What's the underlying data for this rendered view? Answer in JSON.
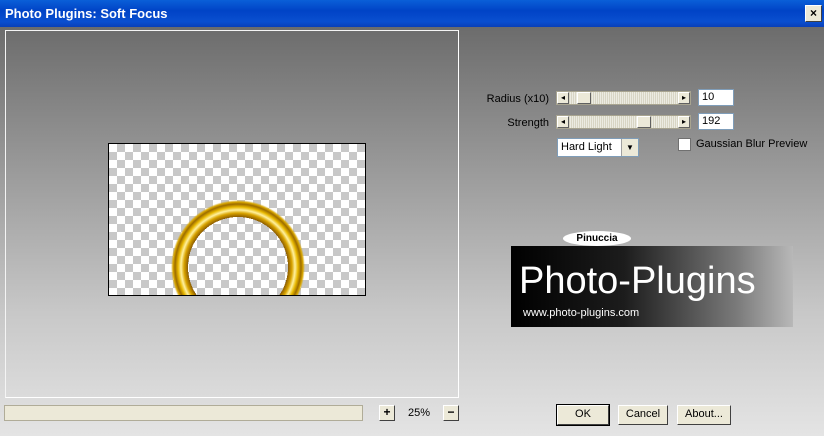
{
  "window": {
    "title": "Photo Plugins: Soft Focus",
    "close_label": "×"
  },
  "controls": {
    "radius": {
      "label": "Radius (x10)",
      "value": "10",
      "slider_fraction": 0.1
    },
    "strength": {
      "label": "Strength",
      "value": "192",
      "slider_fraction": 0.75
    },
    "blend_mode": {
      "selected": "Hard Light"
    },
    "gaussian": {
      "label": "Gaussian Blur Preview",
      "checked": false
    }
  },
  "zoom": {
    "plus": "+",
    "minus": "−",
    "value": "25%"
  },
  "logo": {
    "badge": "Pinuccia",
    "title": "Photo-Plugins",
    "url": "www.photo-plugins.com"
  },
  "buttons": {
    "ok": "OK",
    "cancel": "Cancel",
    "about": "About..."
  },
  "icons": {
    "slider_left": "◂",
    "slider_right": "▸",
    "dropdown": "▼"
  }
}
